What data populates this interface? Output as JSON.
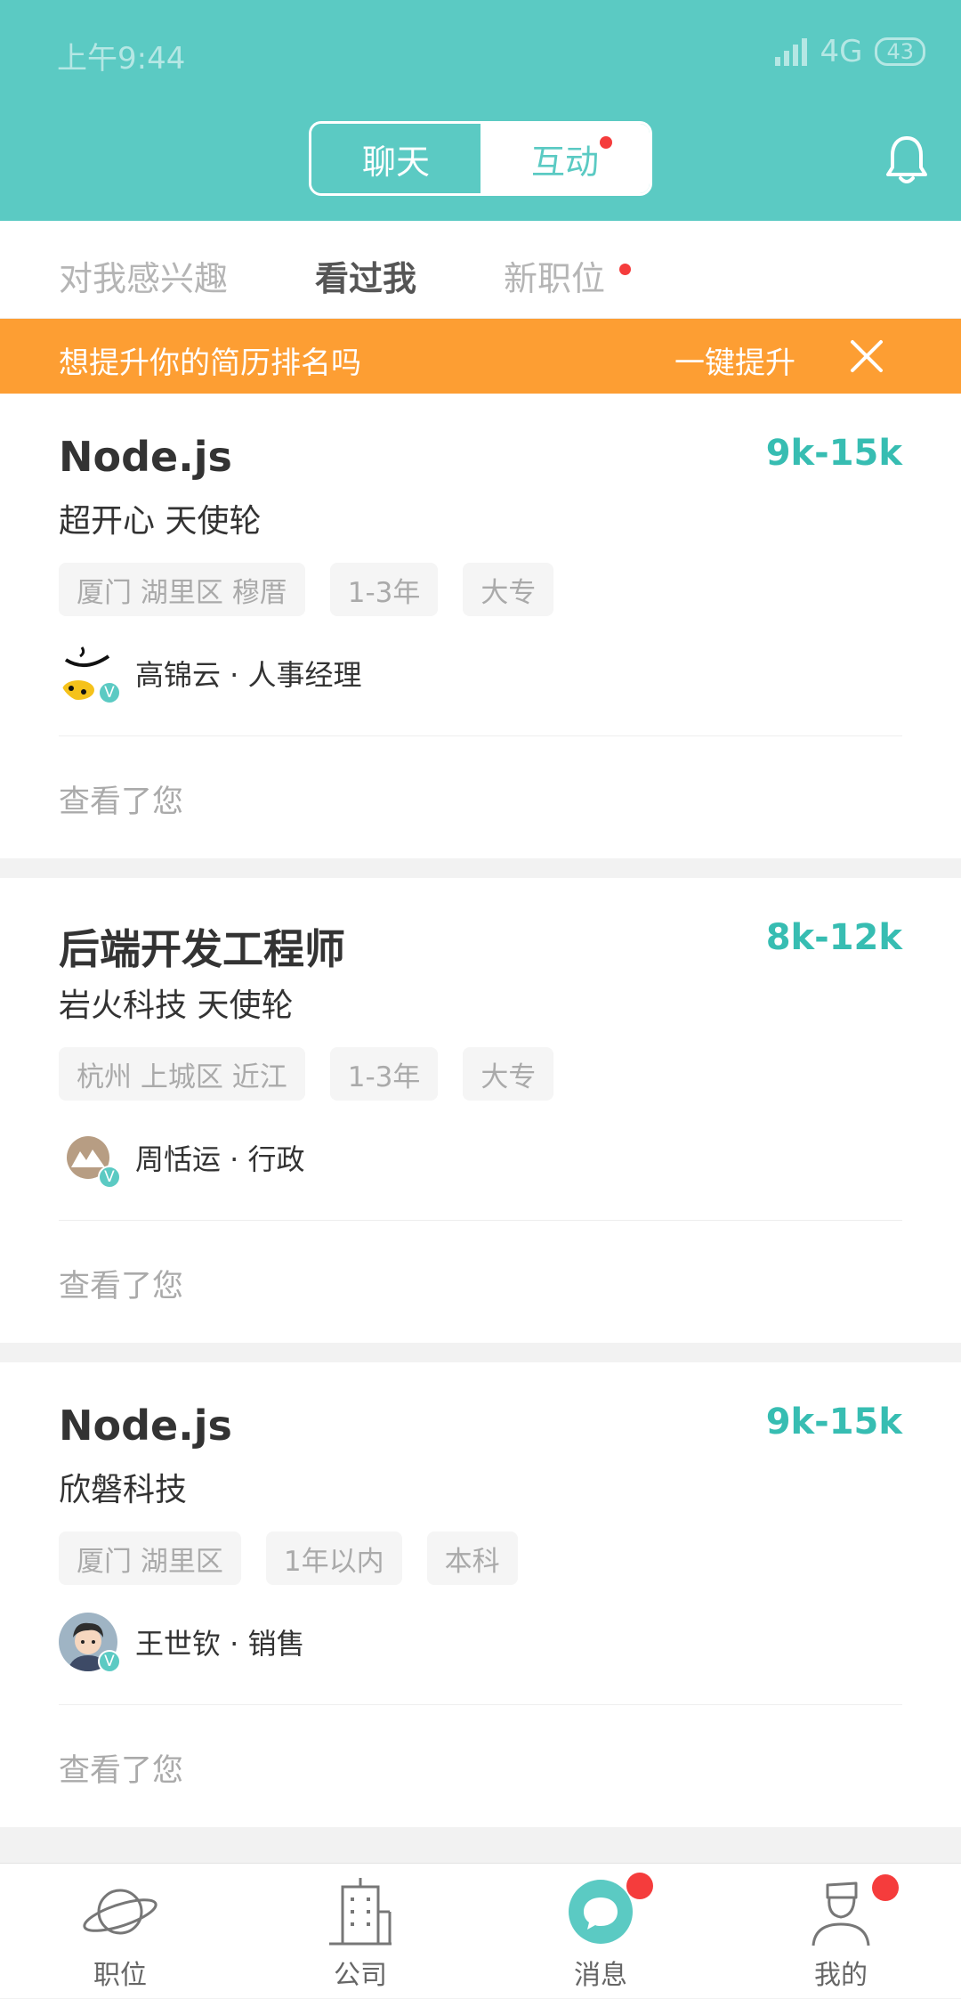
{
  "status_bar": {
    "time": "上午9:44",
    "network": "4G",
    "battery": "43"
  },
  "header": {
    "tabs": [
      {
        "label": "聊天"
      },
      {
        "label": "互动"
      }
    ]
  },
  "subtabs": [
    {
      "label": "对我感兴趣"
    },
    {
      "label": "看过我"
    },
    {
      "label": "新职位"
    }
  ],
  "banner": {
    "text": "想提升你的简历排名吗",
    "action": "一键提升"
  },
  "cards": [
    {
      "title": "Node.js",
      "salary": "9k-15k",
      "company": "超开心  天使轮",
      "tags": [
        "厦门 湖里区 穆厝",
        "1-3年",
        "大专"
      ],
      "recruiter": "高锦云 · 人事经理",
      "verified_badge": "V",
      "viewed": "查看了您"
    },
    {
      "title": "后端开发工程师",
      "salary": "8k-12k",
      "company": "岩火科技  天使轮",
      "tags": [
        "杭州 上城区 近江",
        "1-3年",
        "大专"
      ],
      "recruiter": "周恬运 · 行政",
      "verified_badge": "V",
      "viewed": "查看了您"
    },
    {
      "title": "Node.js",
      "salary": "9k-15k",
      "company": "欣磐科技",
      "tags": [
        "厦门 湖里区",
        "1年以内",
        "本科"
      ],
      "recruiter": "王世钦 · 销售",
      "verified_badge": "V",
      "viewed": "查看了您"
    }
  ],
  "bottom_nav": [
    {
      "label": "职位",
      "icon": "planet-icon"
    },
    {
      "label": "公司",
      "icon": "building-icon"
    },
    {
      "label": "消息",
      "icon": "chat-bubble-icon"
    },
    {
      "label": "我的",
      "icon": "profile-icon"
    }
  ],
  "colors": {
    "primary": "#5bcac3",
    "salary": "#37bdb2",
    "banner": "#fd9e33",
    "badge": "#f53c3c"
  }
}
